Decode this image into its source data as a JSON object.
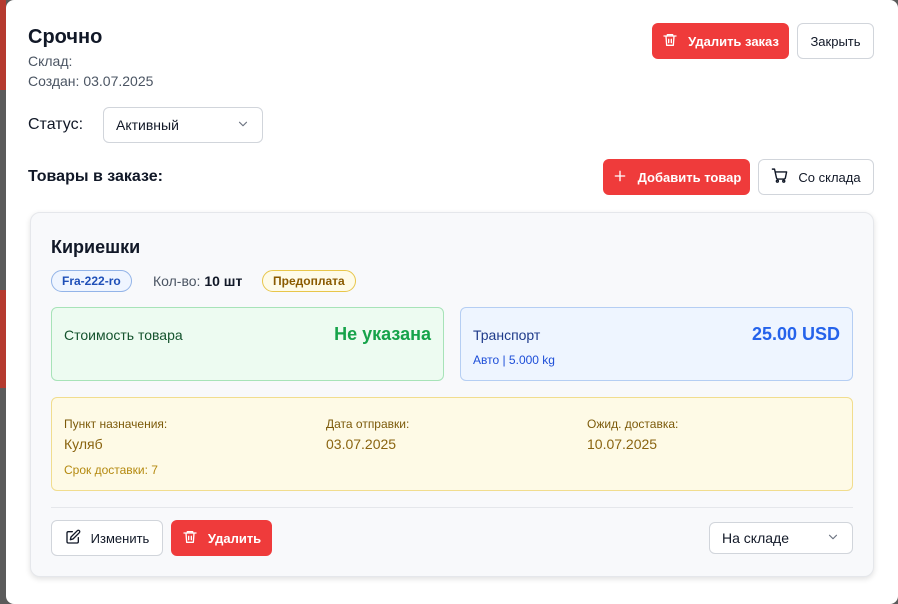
{
  "order": {
    "title": "Срочно",
    "warehouse_label": "Склад:",
    "created_label": "Создан: 03.07.2025",
    "delete_order_label": "Удалить заказ",
    "close_label": "Закрыть",
    "status_label": "Статус:",
    "status_value": "Активный",
    "items_label": "Товары в заказе:",
    "add_item_label": "Добавить товар",
    "from_warehouse_label": "Со склада"
  },
  "item": {
    "name": "Кириешки",
    "sku": "Fra-222-ro",
    "qty_label": "Кол-во:",
    "qty_value": "10 шт",
    "payment_badge": "Предоплата",
    "cost_label": "Стоимость товара",
    "cost_value": "Не указана",
    "transport_label": "Транспорт",
    "transport_value": "25.00 USD",
    "transport_details": "Авто | 5.000 kg",
    "destination_label": "Пункт назначения:",
    "destination_value": "Куляб",
    "ship_date_label": "Дата отправки:",
    "ship_date_value": "03.07.2025",
    "eta_label": "Ожид. доставка:",
    "eta_value": "10.07.2025",
    "delivery_term": "Срок доставки: 7",
    "edit_label": "Изменить",
    "delete_label": "Удалить",
    "location_value": "На складе"
  },
  "colors": {
    "accent_red": "#ef3b3b",
    "success_green": "#16a34a",
    "transport_blue": "#2563eb"
  },
  "icons": [
    "trash-icon",
    "plus-icon",
    "cart-icon",
    "chevron-down-icon",
    "edit-icon"
  ]
}
